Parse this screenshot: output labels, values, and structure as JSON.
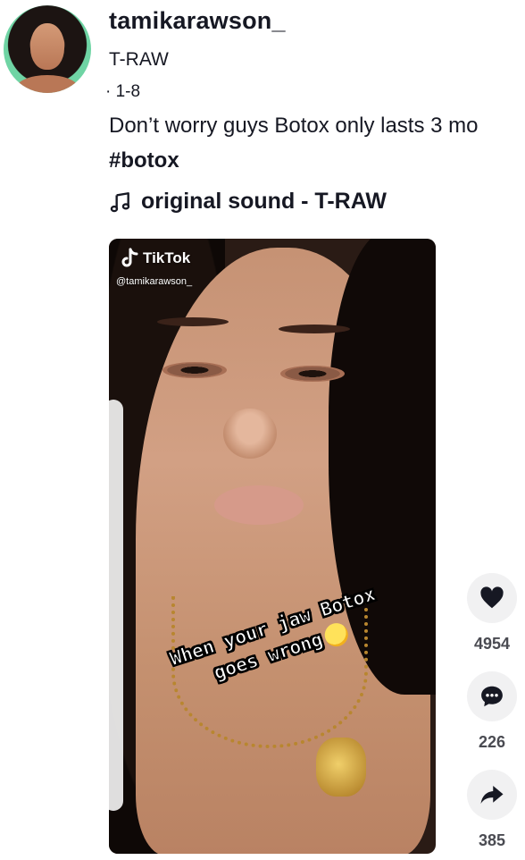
{
  "author": {
    "username": "tamikarawson_",
    "nickname": "T-RAW",
    "date": "· 1-8",
    "avatar_icon": "profile-photo"
  },
  "post": {
    "caption": "Don’t worry guys Botox only lasts 3 mo",
    "hashtag": "#botox",
    "sound": "original sound - T-RAW",
    "sound_icon": "music-note-icon"
  },
  "video": {
    "watermark_brand": "TikTok",
    "watermark_handle": "@tamikarawson_",
    "overlay_line1": "When your jaw Botox",
    "overlay_line2": "goes wrong",
    "overlay_emoji": "rolling-on-floor-laughing-emoji"
  },
  "actions": {
    "likes": "4954",
    "comments": "226",
    "shares": "385",
    "button_bg": "#f1f1f2",
    "icon_color": "#161823"
  },
  "colors": {
    "text": "#161823",
    "count_text": "#4a4b52",
    "background": "#ffffff"
  }
}
